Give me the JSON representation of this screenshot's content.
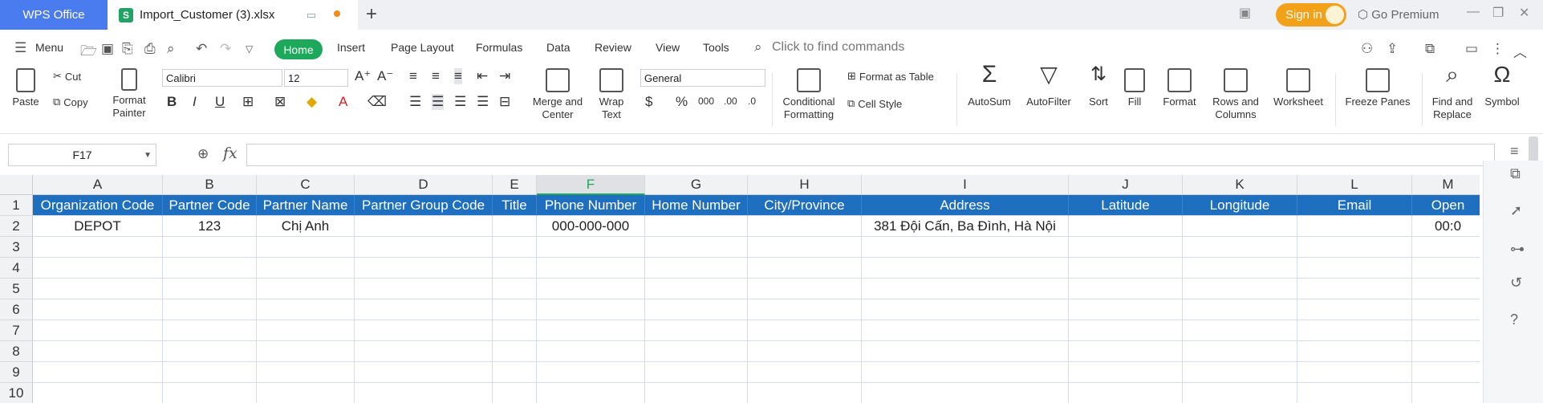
{
  "titlebar": {
    "app_tab": "WPS Office",
    "file_icon": "S",
    "file_name": "Import_Customer (3).xlsx",
    "new_tab": "+",
    "sign_in": "Sign in",
    "premium": "Go Premium"
  },
  "menubar": {
    "menu_label": "Menu",
    "tabs": [
      "Home",
      "Insert",
      "Page Layout",
      "Formulas",
      "Data",
      "Review",
      "View",
      "Tools"
    ],
    "search_placeholder": "Click to find commands"
  },
  "ribbon": {
    "paste": "Paste",
    "cut": "Cut",
    "copy": "Copy",
    "format_painter_1": "Format",
    "format_painter_2": "Painter",
    "font_name": "Calibri",
    "font_size": "12",
    "merge_1": "Merge and",
    "merge_2": "Center",
    "wrap_1": "Wrap",
    "wrap_2": "Text",
    "number_format": "General",
    "cond_1": "Conditional",
    "cond_2": "Formatting",
    "format_as_table": "Format as Table",
    "cell_style": "Cell Style",
    "autosum": "AutoSum",
    "autofilter": "AutoFilter",
    "sort": "Sort",
    "fill": "Fill",
    "format": "Format",
    "rows_cols_1": "Rows and",
    "rows_cols_2": "Columns",
    "worksheet": "Worksheet",
    "freeze": "Freeze Panes",
    "find_1": "Find and",
    "find_2": "Replace",
    "symbol": "Symbol"
  },
  "formula_bar": {
    "name_box": "F17",
    "fx": "fx",
    "formula": ""
  },
  "sheet": {
    "columns": [
      "A",
      "B",
      "C",
      "D",
      "E",
      "F",
      "G",
      "H",
      "I",
      "J",
      "K",
      "L",
      "M"
    ],
    "rows": [
      "1",
      "2",
      "3",
      "4",
      "5",
      "6",
      "7",
      "8",
      "9",
      "10"
    ],
    "header_row": [
      "Organization Code",
      "Partner Code",
      "Partner Name",
      "Partner Group Code",
      "Title",
      "Phone Number",
      "Home Number",
      "City/Province",
      "Address",
      "Latitude",
      "Longitude",
      "Email",
      "Open"
    ],
    "data_row": [
      "DEPOT",
      "123",
      "Chị Anh",
      "",
      "",
      "000-000-000",
      "",
      "",
      "381 Đội Cấn, Ba Đình, Hà Nội",
      "",
      "",
      "",
      "00:0"
    ]
  },
  "colors": {
    "accent_green": "#1ea85c",
    "wps_blue": "#4a7cf0",
    "header_fill": "#1e6fbf",
    "sign_in_orange": "#f4a11a"
  }
}
